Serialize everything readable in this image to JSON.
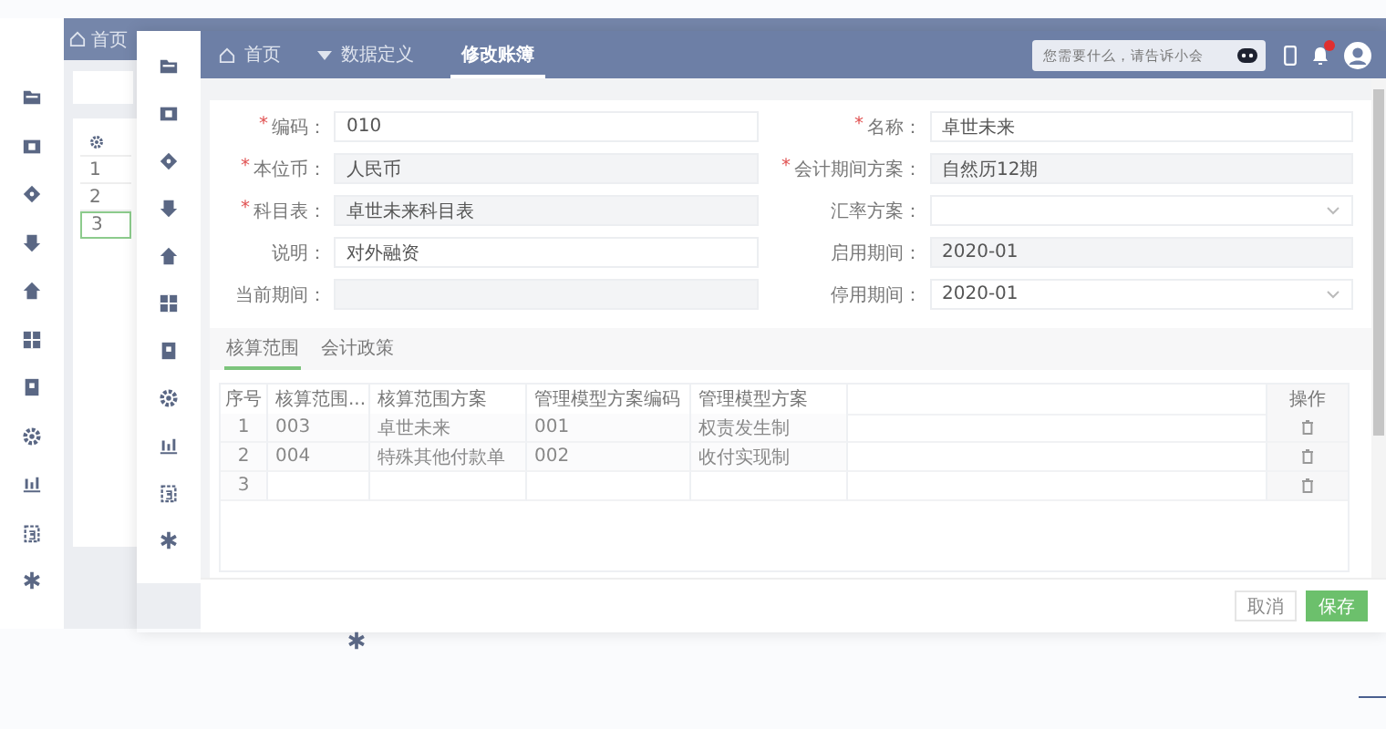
{
  "back_window": {
    "nav": [
      {
        "label": "首页"
      }
    ],
    "list_rows": [
      {
        "label": "1",
        "selected": false
      },
      {
        "label": "2",
        "selected": false
      },
      {
        "label": "3",
        "selected": true
      }
    ]
  },
  "window": {
    "nav": [
      {
        "label": "首页",
        "kind": "home",
        "selected": false
      },
      {
        "label": "数据定义",
        "kind": "dropdown",
        "selected": false
      },
      {
        "label": "修改账簿",
        "kind": "plain",
        "selected": true
      }
    ],
    "search": {
      "placeholder": "您需要什么，请告诉小会"
    },
    "bell": {
      "unread": true
    }
  },
  "form": {
    "fields": [
      {
        "label": "编码：",
        "required_mark": "*",
        "kind": "text",
        "value": "010"
      },
      {
        "label": "名称：",
        "required_mark": "*",
        "kind": "text",
        "value": "卓世未来"
      },
      {
        "label": "本位币：",
        "required_mark": "*",
        "kind": "readonly",
        "value": "人民币"
      },
      {
        "label": "会计期间方案：",
        "required_mark": "*",
        "kind": "readonly",
        "value": "自然历12期"
      },
      {
        "label": "科目表：",
        "required_mark": "*",
        "kind": "readonly",
        "value": "卓世未来科目表"
      },
      {
        "label": "汇率方案：",
        "kind": "select"
      },
      {
        "label": "说明：",
        "kind": "text",
        "value": "对外融资"
      },
      {
        "label": "启用期间：",
        "kind": "readonly",
        "value": "2020-01"
      },
      {
        "label": "当前期间：",
        "kind": "readonly"
      },
      {
        "label": "停用期间：",
        "kind": "select",
        "value": "2020-01"
      }
    ]
  },
  "subtabs": [
    {
      "label": "核算范围",
      "selected": true
    },
    {
      "label": "会计政策",
      "selected": false
    }
  ],
  "table": {
    "columns": [
      "序号",
      "核算范围...",
      "核算范围方案",
      "管理模型方案编码",
      "管理模型方案",
      "",
      "操作"
    ],
    "rows": [
      [
        "1",
        "003",
        "卓世未来",
        "001",
        "权责发生制"
      ],
      [
        "2",
        "004",
        "特殊其他付款单",
        "002",
        "收付实现制"
      ],
      [
        "3"
      ]
    ]
  },
  "buttons": [
    {
      "label": "取消",
      "kind": "secondary"
    },
    {
      "label": "保存",
      "kind": "primary"
    }
  ]
}
